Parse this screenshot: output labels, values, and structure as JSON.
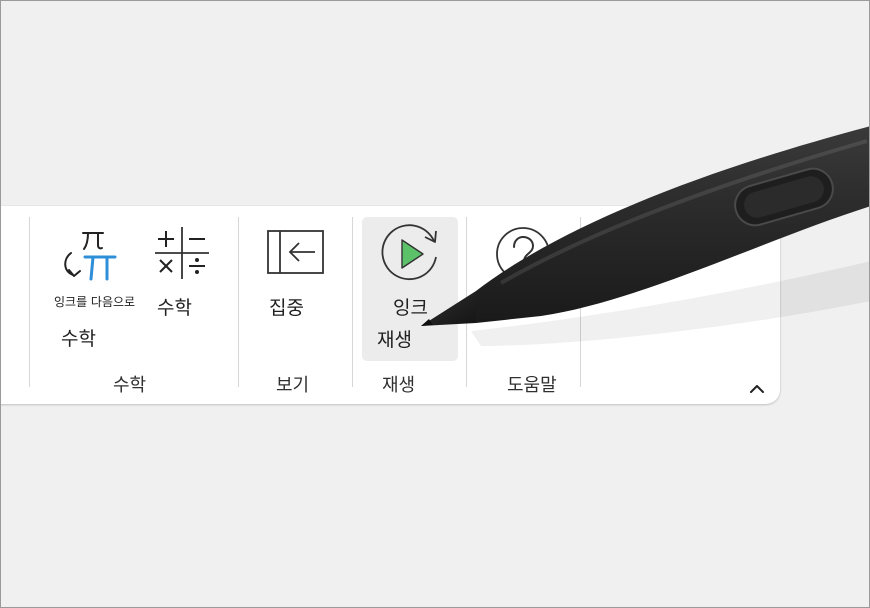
{
  "ribbon": {
    "math_group": {
      "ink_to_math": {
        "line1": "잉크를 다음으로",
        "line2": "수학",
        "icon": "ink-to-math-icon"
      },
      "math": {
        "label": "수학",
        "icon": "math-operators-icon"
      },
      "group_label": "수학"
    },
    "view_group": {
      "focus": {
        "label": "집중",
        "icon": "focus-icon"
      },
      "group_label": "보기"
    },
    "replay_group": {
      "ink_replay": {
        "line1": "잉크",
        "line2": "재생",
        "icon": "replay-icon"
      },
      "group_label": "재생"
    },
    "help_group": {
      "help": {
        "icon": "question-icon"
      },
      "group_label": "도움말"
    },
    "collapse": {
      "icon": "chevron-up-icon"
    }
  },
  "colors": {
    "accent_blue": "#2e8fd8",
    "play_green": "#5cc26a",
    "background": "#f0f0f0",
    "ribbon_bg": "#ffffff"
  },
  "overlay": {
    "object": "stylus-pen"
  }
}
